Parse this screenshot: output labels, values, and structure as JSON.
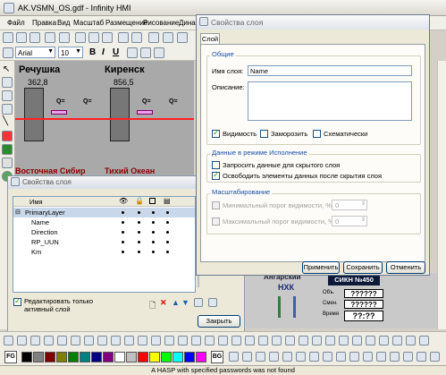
{
  "window": {
    "title": "AK.VSMN_OS.gdf - Infinity HMI"
  },
  "menu": [
    "Файл",
    "Правка",
    "Вид",
    "Масштаб",
    "Размещение",
    "Рисование",
    "Дина"
  ],
  "format_bar": {
    "font": "Arial",
    "size": "10"
  },
  "canvas": {
    "station1": "Речушка",
    "station2": "Киренск",
    "value1": "362,8",
    "value2": "856,5",
    "q1": "Q=",
    "q2": "Q=",
    "q3": "Q=",
    "q4": "Q=",
    "bottom_text1": "Восточная Сибир",
    "bottom_text2": "Тихий Океан"
  },
  "layers_panel": {
    "title": "Свойства слоя",
    "col_name": "Имя",
    "rows": [
      {
        "name": "PrimaryLayer",
        "level": 0,
        "selected": true
      },
      {
        "name": "Name",
        "level": 1
      },
      {
        "name": "Direction",
        "level": 1
      },
      {
        "name": "RP_UUN",
        "level": 1
      },
      {
        "name": "Km",
        "level": 1
      }
    ],
    "edit_only_active": "Редактировать только активный слой",
    "close": "Закрыть"
  },
  "dialog": {
    "title": "Свойства слоя",
    "tab": "Слой",
    "general_group": "Общие",
    "name_label": "Имя слоя:",
    "name_value": "Name",
    "desc_label": "Описание:",
    "visibility": "Видимость",
    "freeze": "Заморозить",
    "schematic": "Схематически",
    "runtime_group": "Данные в режиме Исполнение",
    "request_hidden": "Запросить данные для скрытого слоя",
    "free_after_hide": "Освободить элементы данных после скрытия слоя",
    "scale_group": "Масштабирование",
    "min_threshold": "Минимальный порог видимости, %:",
    "max_threshold": "Максимальный порог видимости, %:",
    "min_value": "0",
    "max_value": "0",
    "apply": "Применить",
    "save": "Сохранить",
    "cancel": "Отменить"
  },
  "bottom_canvas": {
    "org_line1": "Ангарский",
    "org_line2": "НХК",
    "sikn": "СИКН №450",
    "label_ob": "Объ.",
    "label_smen": "Смен.",
    "label_time": "Время",
    "qmarks1": "??????",
    "qmarks2": "??????",
    "time": "??:??"
  },
  "colors": {
    "palette": [
      "#000000",
      "#808080",
      "#800000",
      "#808000",
      "#008000",
      "#008080",
      "#000080",
      "#800080",
      "#ffffff",
      "#c0c0c0",
      "#ff0000",
      "#ffff00",
      "#00ff00",
      "#00ffff",
      "#0000ff",
      "#ff00ff"
    ]
  },
  "bottom_toolbar": {
    "fg": "FG",
    "bg": "BG"
  },
  "status": "A HASP with specified passwords was not found"
}
